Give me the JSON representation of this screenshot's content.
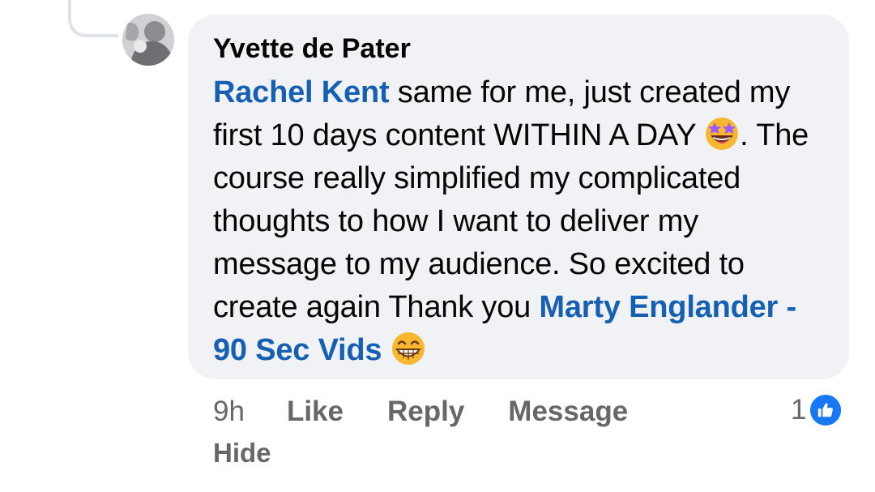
{
  "comment": {
    "author": "Yvette de Pater",
    "segments": {
      "mention_1": "Rachel Kent",
      "text_1": " same for me, just created my first 10 days content WITHIN A DAY ",
      "emoji_1": "star-struck-emoji",
      "text_2": ". The course really simplified my complicated thoughts to how I want to deliver my message to my audience. So excited to create again Thank you ",
      "mention_2": "Marty Englander - 90 Sec Vids",
      "emoji_2": "grinning-emoji"
    }
  },
  "actions": {
    "time": "9h",
    "like": "Like",
    "reply": "Reply",
    "message": "Message",
    "hide": "Hide"
  },
  "reactions": {
    "count": "1",
    "type": "like-icon",
    "badge_color": "#1877f2"
  },
  "colors": {
    "bubble": "#f0f2f5",
    "mention": "#1660b4",
    "meta": "#65676b"
  }
}
